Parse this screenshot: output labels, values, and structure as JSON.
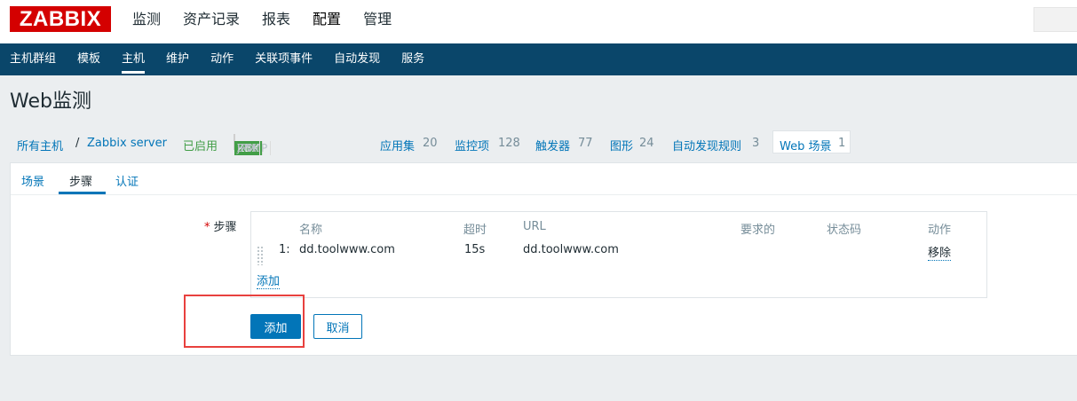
{
  "logo": "ZABBIX",
  "main_menu": [
    "监测",
    "资产记录",
    "报表",
    "配置",
    "管理"
  ],
  "active_main_menu": "配置",
  "sub_menu": [
    "主机群组",
    "模板",
    "主机",
    "维护",
    "动作",
    "关联项事件",
    "自动发现",
    "服务"
  ],
  "active_sub_menu": "主机",
  "page_title": "Web监测",
  "breadcrumb": {
    "all_hosts": "所有主机",
    "separator": "/",
    "host": "Zabbix server",
    "status": "已启用",
    "availability": [
      "ZBX",
      "SNMP",
      "JMX",
      "IPMI"
    ],
    "applications": {
      "label": "应用集",
      "count": "20"
    },
    "items": {
      "label": "监控项",
      "count": "128"
    },
    "triggers": {
      "label": "触发器",
      "count": "77"
    },
    "graphs": {
      "label": "图形",
      "count": "24"
    },
    "discovery": {
      "label": "自动发现规则",
      "count": "3"
    },
    "web": {
      "label": "Web 场景",
      "count": "1"
    }
  },
  "tabs": [
    "场景",
    "步骤",
    "认证"
  ],
  "active_tab": "步骤",
  "steps": {
    "label": "步骤",
    "required_mark": "*",
    "columns": [
      "名称",
      "超时",
      "URL",
      "要求的",
      "状态码",
      "动作"
    ],
    "rows": [
      {
        "num": "1:",
        "name": "dd.toolwww.com",
        "timeout": "15s",
        "url": "dd.toolwww.com",
        "required": "",
        "status_codes": "",
        "action": "移除"
      }
    ],
    "add_link": "添加"
  },
  "buttons": {
    "add": "添加",
    "cancel": "取消"
  },
  "colors": {
    "brand_red": "#d40000",
    "nav_blue": "#0a466a",
    "link_blue": "#0275b8",
    "enabled_green": "#429e47",
    "highlight_red": "#e8413e"
  }
}
